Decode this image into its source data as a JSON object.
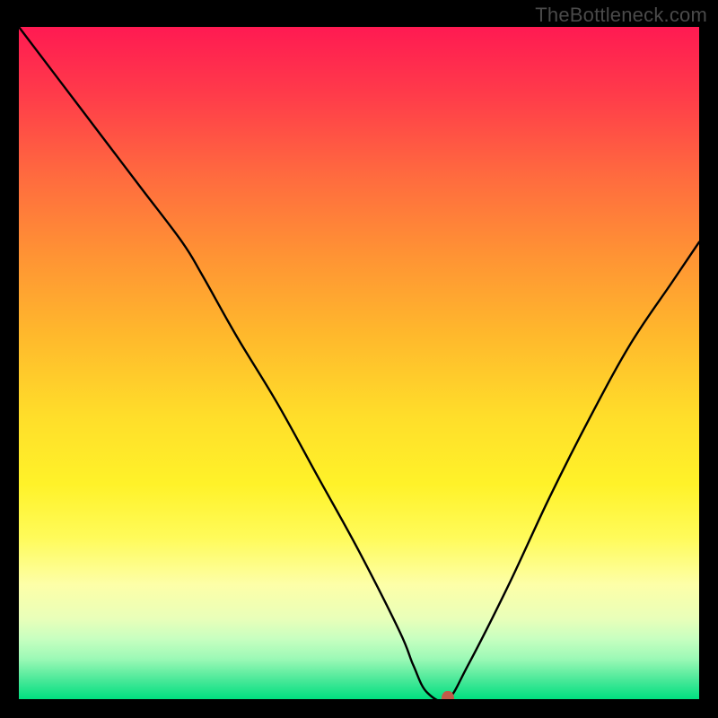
{
  "watermark": "TheBottleneck.com",
  "chart_data": {
    "type": "line",
    "title": "",
    "xlabel": "",
    "ylabel": "",
    "xlim": [
      0,
      100
    ],
    "ylim": [
      0,
      100
    ],
    "x": [
      0,
      6,
      12,
      18,
      24,
      27,
      32,
      38,
      44,
      50,
      56,
      58,
      60,
      63,
      66,
      72,
      78,
      84,
      90,
      96,
      100
    ],
    "values": [
      100,
      92,
      84,
      76,
      68,
      63,
      54,
      44,
      33,
      22,
      10,
      5,
      1,
      0,
      5,
      17,
      30,
      42,
      53,
      62,
      68
    ],
    "marker": {
      "x": 63,
      "y": 0,
      "color": "#c15b49"
    },
    "background_gradient": {
      "direction": "vertical",
      "stops": [
        {
          "pos": 0.0,
          "color": "#ff1a52"
        },
        {
          "pos": 0.34,
          "color": "#ff9334"
        },
        {
          "pos": 0.58,
          "color": "#ffde2a"
        },
        {
          "pos": 0.83,
          "color": "#fdffa8"
        },
        {
          "pos": 1.0,
          "color": "#00df80"
        }
      ]
    }
  }
}
